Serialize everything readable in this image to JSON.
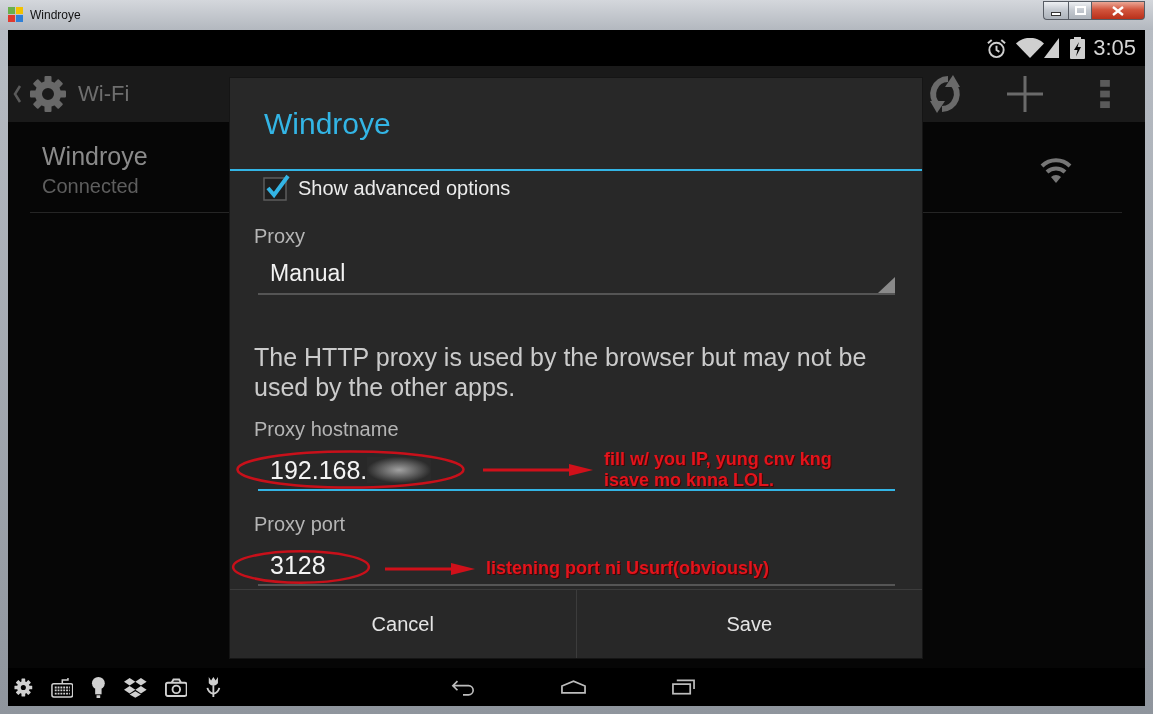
{
  "window": {
    "title": "Windroye"
  },
  "status_bar": {
    "time": "3:05"
  },
  "action_bar": {
    "title": "Wi-Fi"
  },
  "networks": [
    {
      "name": "Windroye",
      "status": "Connected"
    }
  ],
  "dialog": {
    "title": "Windroye",
    "fields": [
      {
        "kind": "checkbox",
        "label": "Show advanced options",
        "checked": true
      },
      {
        "kind": "dropdown",
        "label": "Proxy",
        "value": "Manual"
      },
      {
        "kind": "note",
        "text": "The HTTP proxy is used by the browser but may not be used by the other apps."
      },
      {
        "kind": "input",
        "label": "Proxy hostname",
        "value": "192.168.",
        "redacted": true,
        "focused": true,
        "annotation": "fill w/ you IP, yung cnv kng isave mo knna LOL."
      },
      {
        "kind": "input",
        "label": "Proxy port",
        "value": "3128",
        "redacted": false,
        "focused": false,
        "annotation": "listening port ni Usurf(obviously)"
      }
    ],
    "buttons": [
      "Cancel",
      "Save"
    ]
  }
}
